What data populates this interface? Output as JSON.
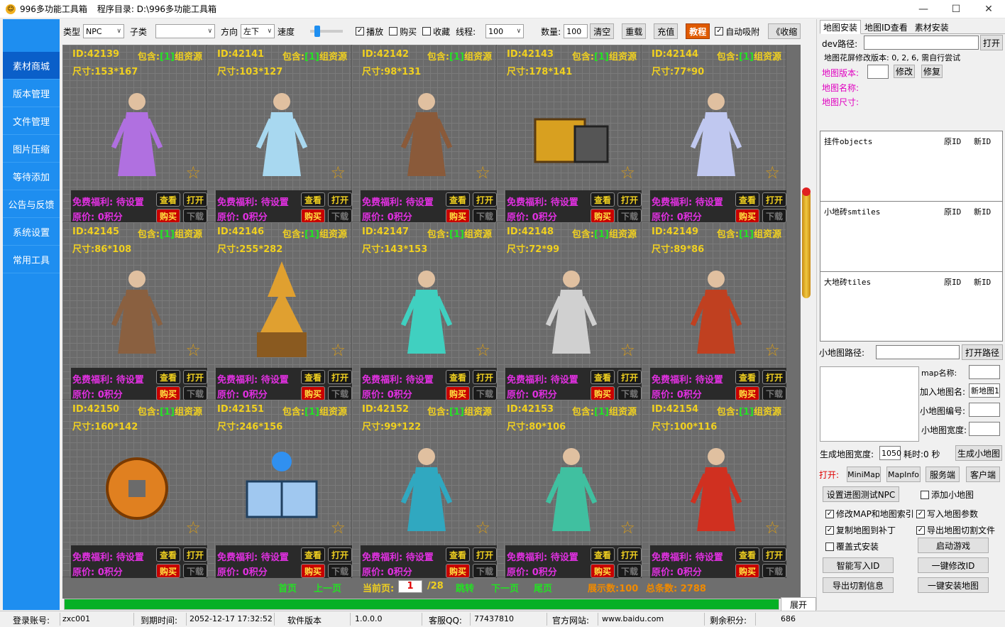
{
  "window": {
    "title": "996多功能工具箱",
    "dir_label": "程序目录: D:\\996多功能工具箱"
  },
  "sidebar": {
    "items": [
      {
        "label": "素材商城",
        "active": true
      },
      {
        "label": "版本管理"
      },
      {
        "label": "文件管理"
      },
      {
        "label": "图片压缩"
      },
      {
        "label": "等待添加"
      },
      {
        "label": "公告与反馈"
      },
      {
        "label": "系统设置"
      },
      {
        "label": "常用工具"
      }
    ]
  },
  "toolbar": {
    "type_label": "类型",
    "type_value": "NPC",
    "subtype_label": "子类",
    "subtype_value": "",
    "dir_label": "方向",
    "dir_value": "左下",
    "speed_label": "速度",
    "play_label": "播放",
    "buy_label": "购买",
    "fav_label": "收藏",
    "thread_label": "线程:",
    "thread_value": "100",
    "qty_label": "数量:",
    "qty_value": "100",
    "clear": "清空",
    "reload": "重载",
    "recharge": "充值",
    "tutorial": "教程",
    "auto_label": "自动吸附",
    "collapse": "《收缩"
  },
  "card_text": {
    "include_prefix": "包含:",
    "include_count": "[1]",
    "include_suffix": "组资源",
    "free": "免费福利: 待设置",
    "price": "原价: 0积分",
    "view": "查看",
    "open": "打开",
    "buy": "购买",
    "download": "下载"
  },
  "cards": [
    {
      "id": "ID:42139",
      "size": "尺寸:153*167",
      "icon": "winged-fairy-npc",
      "color": "#b070e0"
    },
    {
      "id": "ID:42141",
      "size": "尺寸:103*127",
      "icon": "ice-maiden-npc",
      "color": "#a8d8f0"
    },
    {
      "id": "ID:42142",
      "size": "尺寸:98*131",
      "icon": "warrior-npc",
      "color": "#8a5a3a"
    },
    {
      "id": "ID:42143",
      "size": "尺寸:178*141",
      "icon": "treasure-chest",
      "color": "#d8a020"
    },
    {
      "id": "ID:42144",
      "size": "尺寸:77*90",
      "icon": "lady-npc",
      "color": "#c0c8f0"
    },
    {
      "id": "ID:42145",
      "size": "尺寸:86*108",
      "icon": "blacksmith-npc",
      "color": "#8a6040"
    },
    {
      "id": "ID:42146",
      "size": "尺寸:255*282",
      "icon": "pagoda-tower",
      "color": "#e0a030"
    },
    {
      "id": "ID:42147",
      "size": "尺寸:143*153",
      "icon": "jade-fairy-npc",
      "color": "#40d0c0"
    },
    {
      "id": "ID:42148",
      "size": "尺寸:72*99",
      "icon": "reaper-npc",
      "color": "#d0d0d0"
    },
    {
      "id": "ID:42149",
      "size": "尺寸:89*86",
      "icon": "brawler-npc",
      "color": "#c04020"
    },
    {
      "id": "ID:42150",
      "size": "尺寸:160*142",
      "icon": "gold-coin",
      "color": "#e08020"
    },
    {
      "id": "ID:42151",
      "size": "尺寸:246*156",
      "icon": "spell-book",
      "color": "#a0c8f0"
    },
    {
      "id": "ID:42152",
      "size": "尺寸:99*122",
      "icon": "priestess-npc",
      "color": "#30a8c0"
    },
    {
      "id": "ID:42153",
      "size": "尺寸:80*106",
      "icon": "dancer-npc",
      "color": "#40c0a0"
    },
    {
      "id": "ID:42154",
      "size": "尺寸:100*116",
      "icon": "fire-lord-npc",
      "color": "#d03020"
    }
  ],
  "pager": {
    "first": "首页",
    "prev": "上一页",
    "current_label": "当前页:",
    "current": "1",
    "total_pages": "/28",
    "jump": "跳转",
    "next": "下一页",
    "last": "尾页",
    "shown": "展示数:100",
    "total": "总条数: 2788"
  },
  "progress": {
    "value": 1.0
  },
  "expand": "展开",
  "right": {
    "tabs": [
      "地图安装",
      "地图ID查看",
      "素材安装"
    ],
    "dev_label": "dev路径:",
    "dev_value": "",
    "open": "打开",
    "note": "地图花屏修改版本: 0, 2, 6, 需自行尝试",
    "map_version_label": "地图版本:",
    "map_version_value": "",
    "modify": "修改",
    "repair": "修复",
    "map_name_label": "地图名称:",
    "map_size_label": "地图尺寸:",
    "list1": {
      "title": "挂件objects",
      "c1": "原ID",
      "c2": "新ID"
    },
    "list2": {
      "title": "小地砖smtiles",
      "c1": "原ID",
      "c2": "新ID"
    },
    "list3": {
      "title": "大地砖tiles",
      "c1": "原ID",
      "c2": "新ID"
    },
    "minimap_path_label": "小地图路径:",
    "minimap_open": "打开路径",
    "mapname_label": "map名称:",
    "mapname_value": "",
    "addmap_label": "加入地图名:",
    "addmap_value": "新地图1",
    "minimap_no_label": "小地图编号:",
    "minimap_no_value": "",
    "minimap_w_label": "小地图宽度:",
    "minimap_w_value": "",
    "gen_w_label": "生成地图宽度:",
    "gen_w_value": "1050",
    "elapsed": "耗时:0 秒",
    "gen_btn": "生成小地图",
    "open_label": "打开:",
    "minimap": "MiniMap",
    "mapinfo": "MapInfo",
    "server": "服务端",
    "client": "客户端",
    "set_npc": "设置进图测试NPC",
    "add_minimap": "添加小地图",
    "opt1": "修改MAP和地图索引",
    "opt2": "写入地图参数",
    "opt3": "复制地图到补丁",
    "opt4": "导出地图切割文件",
    "opt5": "覆盖式安装",
    "start_game": "启动游戏",
    "smart_write": "智能写入ID",
    "onekey_modify": "一键修改ID",
    "export_cut": "导出切割信息",
    "onekey_install": "一键安装地图"
  },
  "status": {
    "account_label": "登录账号:",
    "account": "zxc001",
    "expire_label": "到期时间:",
    "expire": "2052-12-17 17:32:52",
    "version_label": "软件版本",
    "version": "1.0.0.0",
    "qq_label": "客服QQ:",
    "qq": "77437810",
    "site_label": "官方网站:",
    "site": "www.baidu.com",
    "points_label": "剩余积分:",
    "points": "686"
  }
}
